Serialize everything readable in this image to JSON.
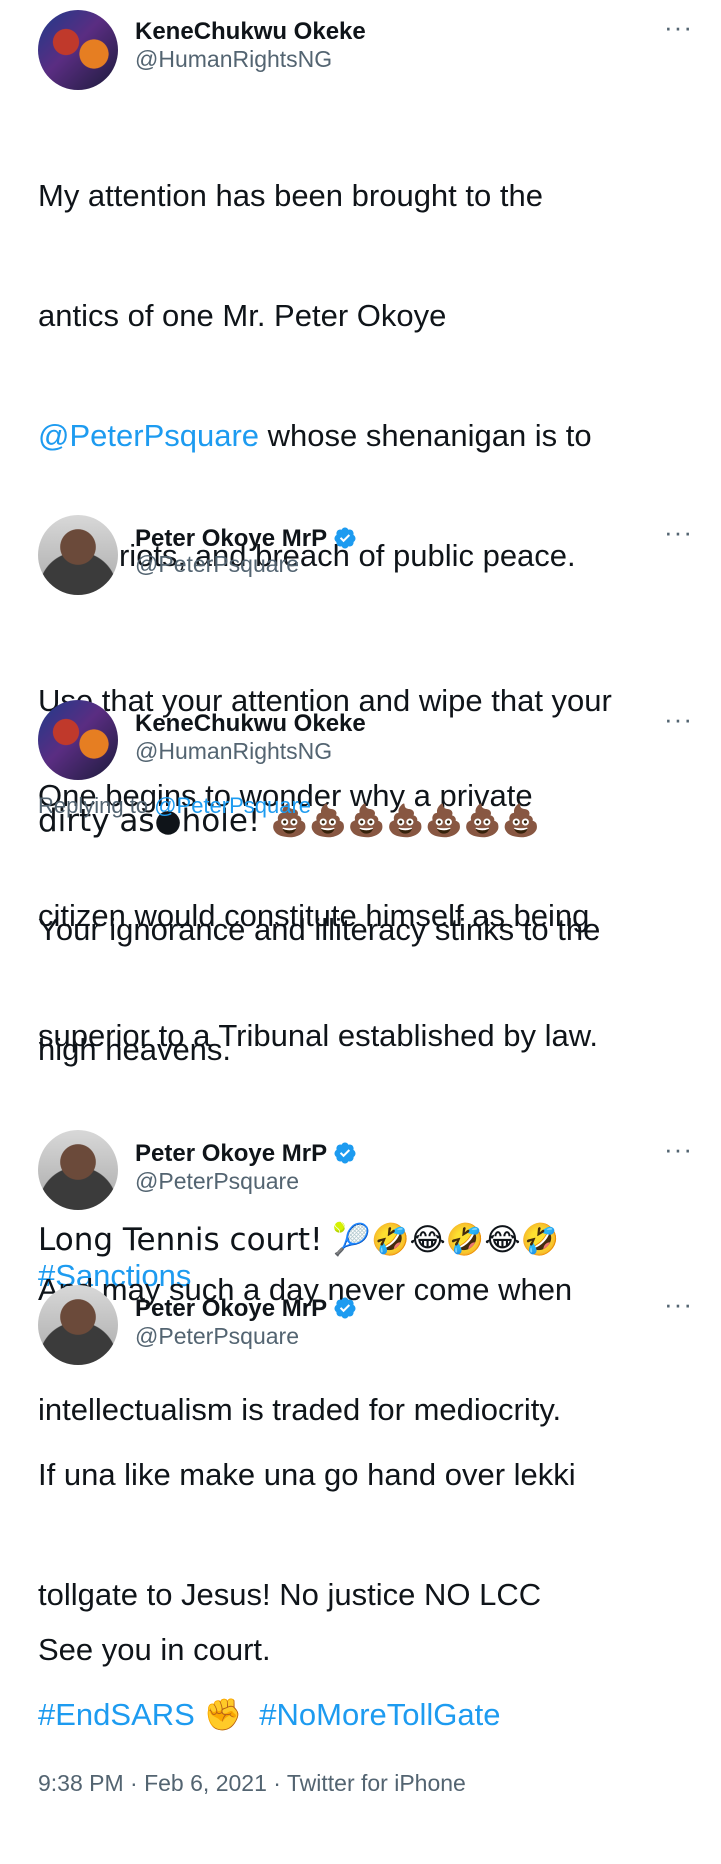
{
  "tweets": [
    {
      "name": "KeneChukwu Okeke",
      "handle": "@HumanRightsNG",
      "more": "···",
      "p1a": "My attention has been brought to the",
      "p1b": "antics of one Mr. Peter Okoye",
      "p1_mention": "@PeterPsquare",
      "p1c": " whose shenanigan is to",
      "p1d": "incite riots, and breach of public peace.",
      "p2a": "One begins to wonder why a private",
      "p2b": "citizen would constitute himself as being",
      "p2c": "superior to a Tribunal established by law.",
      "hashtag": "#Sanctions"
    },
    {
      "name": "Peter Okoye MrP",
      "handle": "@PeterPsquare",
      "more": "···",
      "line1": "Use that your attention and wipe that your",
      "line2": "dirty as●hole! 💩💩💩💩💩💩💩"
    },
    {
      "name": "KeneChukwu Okeke",
      "handle": "@HumanRightsNG",
      "more": "···",
      "replying_prefix": "Replying to ",
      "replying_handle": "@PeterPsquare",
      "p1a": "Your ignorance and illiteracy stinks to the",
      "p1b": "high heavens.",
      "p2a": "And may such a day never come when",
      "p2b": "intellectualism is traded for mediocrity.",
      "p3": "See you in court."
    },
    {
      "name": "Peter Okoye MrP",
      "handle": "@PeterPsquare",
      "more": "···",
      "text": "Long Tennis court! 🎾🤣😂🤣😂🤣"
    },
    {
      "name": "Peter Okoye MrP",
      "handle": "@PeterPsquare",
      "more": "···",
      "line1": "If una like make una go hand over lekki",
      "line2": "tollgate to Jesus! No justice NO LCC",
      "hashtag1": "#EndSARS",
      "emoji": "✊",
      "hashtag2": "#NoMoreTollGate"
    }
  ],
  "footer": {
    "meta": "9:38 PM · Feb 6, 2021 · Twitter for iPhone"
  },
  "colors": {
    "link": "#1d9bf0",
    "text": "#0f1419",
    "secondary": "#536471",
    "verified": "#1d9bf0"
  },
  "icons": {
    "verified": "verified-badge-icon",
    "more": "more-options-icon"
  }
}
